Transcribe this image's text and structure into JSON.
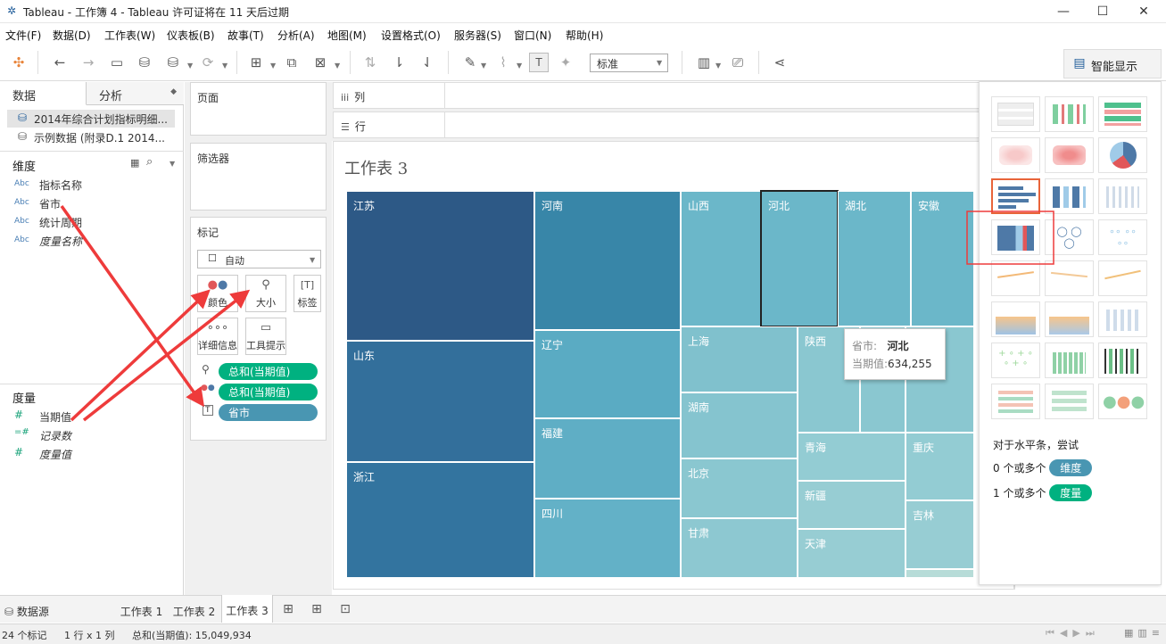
{
  "window": {
    "title": "Tableau - 工作簿 4 - Tableau 许可证将在 11 天后过期",
    "minimize": "—",
    "maximize": "☐",
    "close": "✕"
  },
  "menu": [
    "文件(F)",
    "数据(D)",
    "工作表(W)",
    "仪表板(B)",
    "故事(T)",
    "分析(A)",
    "地图(M)",
    "设置格式(O)",
    "服务器(S)",
    "窗口(N)",
    "帮助(H)"
  ],
  "toolbar": {
    "fit_select": "标准",
    "show_me_label": "智能显示",
    "icons": [
      "tableau-logo-icon",
      "undo-icon",
      "redo-icon",
      "save-icon",
      "new-datasource-icon",
      "pause-update-icon",
      "refresh-icon",
      "new-sheet-icon",
      "duplicate-sheet-icon",
      "clear-sheet-icon",
      "swap-icon",
      "sort-ascending-icon",
      "sort-descending-icon",
      "highlight-icon",
      "group-icon",
      "labels-icon",
      "pin-icon",
      "fit-select",
      "show-cards-icon",
      "presentation-icon",
      "share-icon"
    ]
  },
  "data_pane": {
    "tab_data": "数据",
    "tab_analysis": "分析",
    "datasources": [
      {
        "name": "2014年综合计划指标明细...",
        "active": true
      },
      {
        "name": "示例数据 (附录D.1 2014...",
        "active": false
      }
    ],
    "dimensions_label": "维度",
    "dimensions": [
      {
        "type": "Abc",
        "name": "指标名称",
        "italic": false
      },
      {
        "type": "Abc",
        "name": "省市",
        "italic": false
      },
      {
        "type": "Abc",
        "name": "统计周期",
        "italic": false
      },
      {
        "type": "Abc",
        "name": "度量名称",
        "italic": true
      }
    ],
    "measures_label": "度量",
    "measures": [
      {
        "type": "#",
        "name": "当期值",
        "italic": false
      },
      {
        "type": "=#",
        "name": "记录数",
        "italic": true
      },
      {
        "type": "#",
        "name": "度量值",
        "italic": true
      }
    ]
  },
  "cards": {
    "pages": "页面",
    "filters": "筛选器",
    "marks": "标记",
    "mark_type": "自动",
    "buttons": {
      "color": "颜色",
      "size": "大小",
      "label": "标签",
      "detail": "详细信息",
      "tooltip": "工具提示"
    },
    "pills": [
      {
        "text": "总和(当期值)",
        "color": "#00b180",
        "encoding": "size"
      },
      {
        "text": "总和(当期值)",
        "color": "#00b180",
        "encoding": "color"
      },
      {
        "text": "省市",
        "color": "#4996b2",
        "encoding": "label"
      }
    ]
  },
  "shelves": {
    "columns": "列",
    "rows": "行"
  },
  "sheet": {
    "title": "工作表 3",
    "tooltip": {
      "key1": "省市:",
      "val1": "河北",
      "key2": "当期值:",
      "val2": "634,255"
    }
  },
  "chart_data": {
    "type": "treemap",
    "title": "工作表 3",
    "measure": "总和(当期值)",
    "color_encoding": "总和(当期值)",
    "selected": "河北",
    "known_values": {
      "河北": 634255
    },
    "total": 15049934,
    "items": [
      {
        "label": "江苏",
        "color": "#2d5986"
      },
      {
        "label": "山东",
        "color": "#336f9b"
      },
      {
        "label": "浙江",
        "color": "#33749f"
      },
      {
        "label": "河南",
        "color": "#3886a8"
      },
      {
        "label": "辽宁",
        "color": "#5aabc3"
      },
      {
        "label": "福建",
        "color": "#5faec5"
      },
      {
        "label": "四川",
        "color": "#63b1c7"
      },
      {
        "label": "山西",
        "color": "#6bb7c9"
      },
      {
        "label": "河北",
        "color": "#6bb7c9"
      },
      {
        "label": "湖北",
        "color": "#6bb7c9"
      },
      {
        "label": "安徽",
        "color": "#6bb7c9"
      },
      {
        "label": "上海",
        "color": "#80c1cd"
      },
      {
        "label": "湖南",
        "color": "#85c4cf"
      },
      {
        "label": "北京",
        "color": "#8ac7d0"
      },
      {
        "label": "甘肃",
        "color": "#8dc8d1"
      },
      {
        "label": "陕西",
        "color": "#8ac7d0"
      },
      {
        "label": "",
        "color": "#8ac7d0"
      },
      {
        "label": "",
        "color": "#8ac7d0"
      },
      {
        "label": "青海",
        "color": "#93ccd3"
      },
      {
        "label": "新疆",
        "color": "#97cdd3"
      },
      {
        "label": "天津",
        "color": "#97cdd3"
      },
      {
        "label": "重庆",
        "color": "#93ccd3"
      },
      {
        "label": "吉林",
        "color": "#97cdd3"
      },
      {
        "label": "",
        "color": "#b7dcd8"
      }
    ]
  },
  "show_me": {
    "hint": "对于水平条，尝试",
    "req1_prefix": "0 个或多个",
    "req1_pill": "维度",
    "req2_prefix": "1 个或多个",
    "req2_pill": "度量",
    "thumbnails": [
      "text-table",
      "heat-map",
      "highlight-table",
      "symbol-map",
      "filled-map",
      "pie-chart",
      "horizontal-bars",
      "stacked-bars",
      "side-by-side-bars",
      "treemap",
      "circle-views",
      "side-by-side-circles",
      "lines-continuous",
      "lines-discrete",
      "dual-lines",
      "area-continuous",
      "area-discrete",
      "dual-combination",
      "scatter-plot",
      "histogram",
      "box-whisker",
      "gantt-chart",
      "bullet-graph",
      "packed-bubbles"
    ]
  },
  "sheet_tabs": {
    "datasource": "数据源",
    "tabs": [
      "工作表 1",
      "工作表 2",
      "工作表 3"
    ],
    "active": "工作表 3"
  },
  "status": {
    "marks": "24 个标记",
    "rows_cols": "1 行 x 1 列",
    "sum": "总和(当期值): 15,049,934"
  }
}
